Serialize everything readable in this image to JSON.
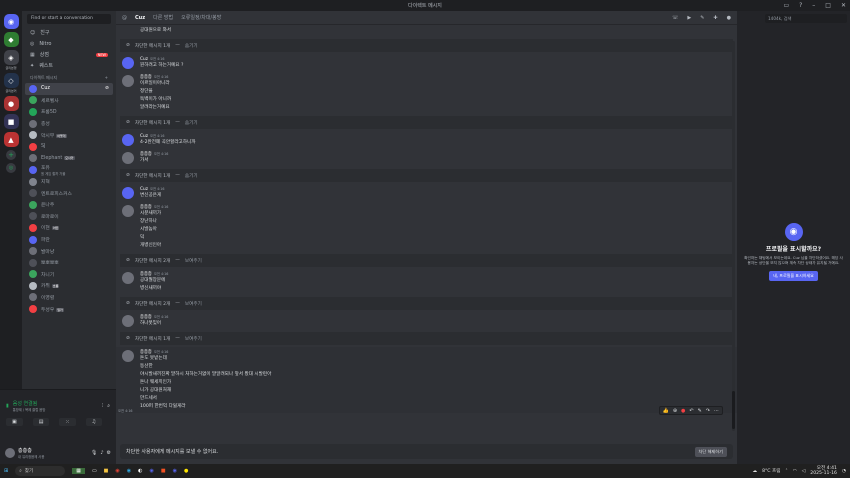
{
  "window": {
    "title": "다이렉트 메시지"
  },
  "guilds": {
    "labels": [
      "글리븐행",
      "글리븐커"
    ]
  },
  "sidebar": {
    "find_placeholder": "Find or start a conversation",
    "nav": [
      {
        "label": "친구",
        "icon": "friends-icon"
      },
      {
        "label": "Nitro",
        "icon": "nitro-icon"
      },
      {
        "label": "상점",
        "icon": "shop-icon",
        "badge": "NEW"
      },
      {
        "label": "퀘스트",
        "icon": "quest-icon"
      }
    ],
    "dm_header": "다이렉트 메시지",
    "dms": [
      {
        "name": "Cuz",
        "color": "#5865f2",
        "active": true
      },
      {
        "name": "세르벨사",
        "color": "#3ba55d"
      },
      {
        "name": "프롬5D",
        "color": "#23a559"
      },
      {
        "name": "층성",
        "color": "#6d6f78"
      },
      {
        "name": "막시무",
        "color": "#b5bac1",
        "tag": "어떻게"
      },
      {
        "name": "SJ",
        "color": "#f23f43"
      },
      {
        "name": "Elephant",
        "color": "#6d6f78",
        "tag": "모사카"
      },
      {
        "name": "포유",
        "color": "#5865f2",
        "sub": "뭔 게임 할까 가볼"
      },
      {
        "name": "지혁",
        "color": "#80848e"
      },
      {
        "name": "엔트로피스커스",
        "color": "#4e5058"
      },
      {
        "name": "윤나주",
        "color": "#3ba55d"
      },
      {
        "name": "로마로이",
        "color": "#4e5058"
      },
      {
        "name": "이현",
        "color": "#f23f43",
        "tag": "어떤"
      },
      {
        "name": "파란",
        "color": "#5865f2"
      },
      {
        "name": "발마냥",
        "color": "#6d6f78"
      },
      {
        "name": "뽀뽀뽀뽀",
        "color": "#4e5058"
      },
      {
        "name": "차니기",
        "color": "#3ba55d"
      },
      {
        "name": "카뮈",
        "color": "#b5bac1",
        "tag": "흐름"
      },
      {
        "name": "이영렬",
        "color": "#6d6f78"
      },
      {
        "name": "두성우",
        "color": "#f23f43",
        "tag": "일카"
      }
    ]
  },
  "voice": {
    "status": "음성 연결됨",
    "sub": "통방제 / 복제 클럽 음방"
  },
  "user": {
    "name": "층층층",
    "sub": "내 유리정음께 사용"
  },
  "channel": {
    "name": "Cuz",
    "header_items": [
      "다른 방법",
      "오류일정/차대/봉방"
    ],
    "search_placeholder": "1404k, 검색"
  },
  "messages": [
    {
      "type": "text_only",
      "lines": [
        "공대원으로 와서"
      ]
    },
    {
      "type": "blocked",
      "text": "차단한 메시지 1개",
      "link": "숨기기"
    },
    {
      "type": "msg",
      "author": "Cuz",
      "time": "오전 4:16",
      "bot": true,
      "lines": [
        "뭔하려고 하는거예요 ?"
      ]
    },
    {
      "type": "msg",
      "author": "층층층",
      "time": "오전 4:16",
      "lines": [
        "이르일이아니라",
        "정단을",
        "독백이가 아니까",
        "알려라는거예요"
      ]
    },
    {
      "type": "blocked",
      "text": "차단한 메시지 1개",
      "link": "숨기기"
    },
    {
      "type": "msg",
      "author": "Cuz",
      "time": "오전 4:16",
      "bot": true,
      "lines": [
        "4-2완전폐 곡안할라고하니까"
      ]
    },
    {
      "type": "msg",
      "author": "층층층",
      "time": "오전 4:16",
      "lines": [
        "가서"
      ]
    },
    {
      "type": "blocked",
      "text": "차단한 메시지 1개",
      "link": "숨기기"
    },
    {
      "type": "msg",
      "author": "Cuz",
      "time": "오전 4:16",
      "bot": true,
      "lines": [
        "변신공은게"
      ]
    },
    {
      "type": "msg",
      "author": "층층층",
      "time": "오전 4:16",
      "lines": [
        "시분새끼가",
        "장난하나",
        "시발놈아",
        "덕",
        "개병신인아"
      ]
    },
    {
      "type": "blocked",
      "text": "차단한 메시지 2개",
      "link": "보여주기"
    },
    {
      "type": "msg",
      "author": "층층층",
      "time": "오전 4:16",
      "lines": [
        "공대월장문에",
        "병신새끼야"
      ]
    },
    {
      "type": "blocked",
      "text": "차단한 메시지 2개",
      "link": "보여주기"
    },
    {
      "type": "msg",
      "author": "층층층",
      "time": "오전 4:16",
      "lines": [
        "하나못잊어"
      ]
    },
    {
      "type": "blocked",
      "text": "차단한 메시지 1개",
      "link": "보여주기"
    },
    {
      "type": "msg",
      "author": "층층층",
      "time": "오전 4:16",
      "lines": [
        "돈도 못받는데",
        "동산한",
        "야시발새끼진짜 말하시 처하는거없이 말알려되나 앞서 봤대 시발련아",
        "돈나 웨세끼인가",
        "니가 공대원처재",
        "만드세서",
        "100퍼 한번익 다잃게라"
      ]
    }
  ],
  "hover_time": "오전 4:16",
  "blocked_bar": {
    "text": "차단한 사용자에게 메시지를 보낼 수 없어요.",
    "button": "차단 해제하기"
  },
  "profile": {
    "title": "프로필을 표시할까요?",
    "body": "확인하는 채팅에서 보이는데요. Cuz 님을 차단하셨어요. 해당 사용자는 상단을 보지 않으며 계속 차단 상태가 유지될 거예요.",
    "button": "네, 프로필을 표시하세요"
  },
  "taskbar": {
    "search": "찾기",
    "weather": "8°C 흐림",
    "time": "오전 4:41",
    "date": "2025-11-16"
  }
}
